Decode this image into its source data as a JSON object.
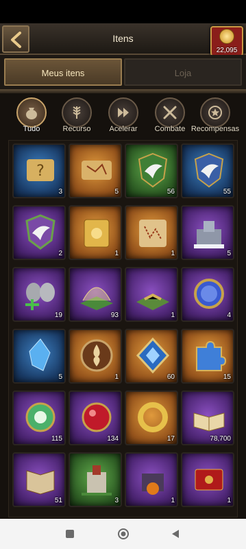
{
  "header": {
    "title": "Itens",
    "coins": "22,095"
  },
  "main_tabs": [
    {
      "label": "Meus itens",
      "active": true
    },
    {
      "label": "Loja",
      "active": false
    }
  ],
  "categories": [
    {
      "label": "Tudo",
      "icon": "bag-icon",
      "active": true
    },
    {
      "label": "Recurso",
      "icon": "wheat-icon",
      "active": false
    },
    {
      "label": "Acelerar",
      "icon": "fast-forward-icon",
      "active": false
    },
    {
      "label": "Combate",
      "icon": "crossed-swords-icon",
      "active": false
    },
    {
      "label": "Recompensas",
      "icon": "star-medal-icon",
      "active": false
    }
  ],
  "items": [
    {
      "name": "mystery-scroll",
      "quantity": "3",
      "rarity": "blue"
    },
    {
      "name": "map-scroll",
      "quantity": "5",
      "rarity": "orange"
    },
    {
      "name": "peace-dove-shield-green",
      "quantity": "56",
      "rarity": "green"
    },
    {
      "name": "peace-dove-shield-blue",
      "quantity": "55",
      "rarity": "blue"
    },
    {
      "name": "peace-dove-shield-purple",
      "quantity": "2",
      "rarity": "purple"
    },
    {
      "name": "golden-scroll-card",
      "quantity": "1",
      "rarity": "orange"
    },
    {
      "name": "treasure-map",
      "quantity": "1",
      "rarity": "orange"
    },
    {
      "name": "snow-castle",
      "quantity": "5",
      "rarity": "purple"
    },
    {
      "name": "soldier-helmets",
      "quantity": "19",
      "rarity": "purple"
    },
    {
      "name": "domed-field",
      "quantity": "93",
      "rarity": "purple"
    },
    {
      "name": "farm-plot",
      "quantity": "1",
      "rarity": "purple"
    },
    {
      "name": "magic-mirror",
      "quantity": "4",
      "rarity": "purple"
    },
    {
      "name": "blue-crystal",
      "quantity": "5",
      "rarity": "blue"
    },
    {
      "name": "fire-emblem-coin",
      "quantity": "1",
      "rarity": "orange"
    },
    {
      "name": "blue-diamond-rune",
      "quantity": "60",
      "rarity": "orange"
    },
    {
      "name": "puzzle-piece",
      "quantity": "15",
      "rarity": "orange"
    },
    {
      "name": "green-orb",
      "quantity": "115",
      "rarity": "purple"
    },
    {
      "name": "red-orb",
      "quantity": "134",
      "rarity": "purple"
    },
    {
      "name": "golden-ring",
      "quantity": "17",
      "rarity": "orange"
    },
    {
      "name": "open-book-laurel",
      "quantity": "78,700",
      "rarity": "purple"
    },
    {
      "name": "red-book",
      "quantity": "51",
      "rarity": "purple"
    },
    {
      "name": "castle-tower",
      "quantity": "3",
      "rarity": "green"
    },
    {
      "name": "pumpkin-castle",
      "quantity": "1",
      "rarity": "purple"
    },
    {
      "name": "red-envelope",
      "quantity": "1",
      "rarity": "purple"
    }
  ],
  "colors": {
    "accent": "#c9a46a",
    "badge": "#8a1e1a"
  }
}
